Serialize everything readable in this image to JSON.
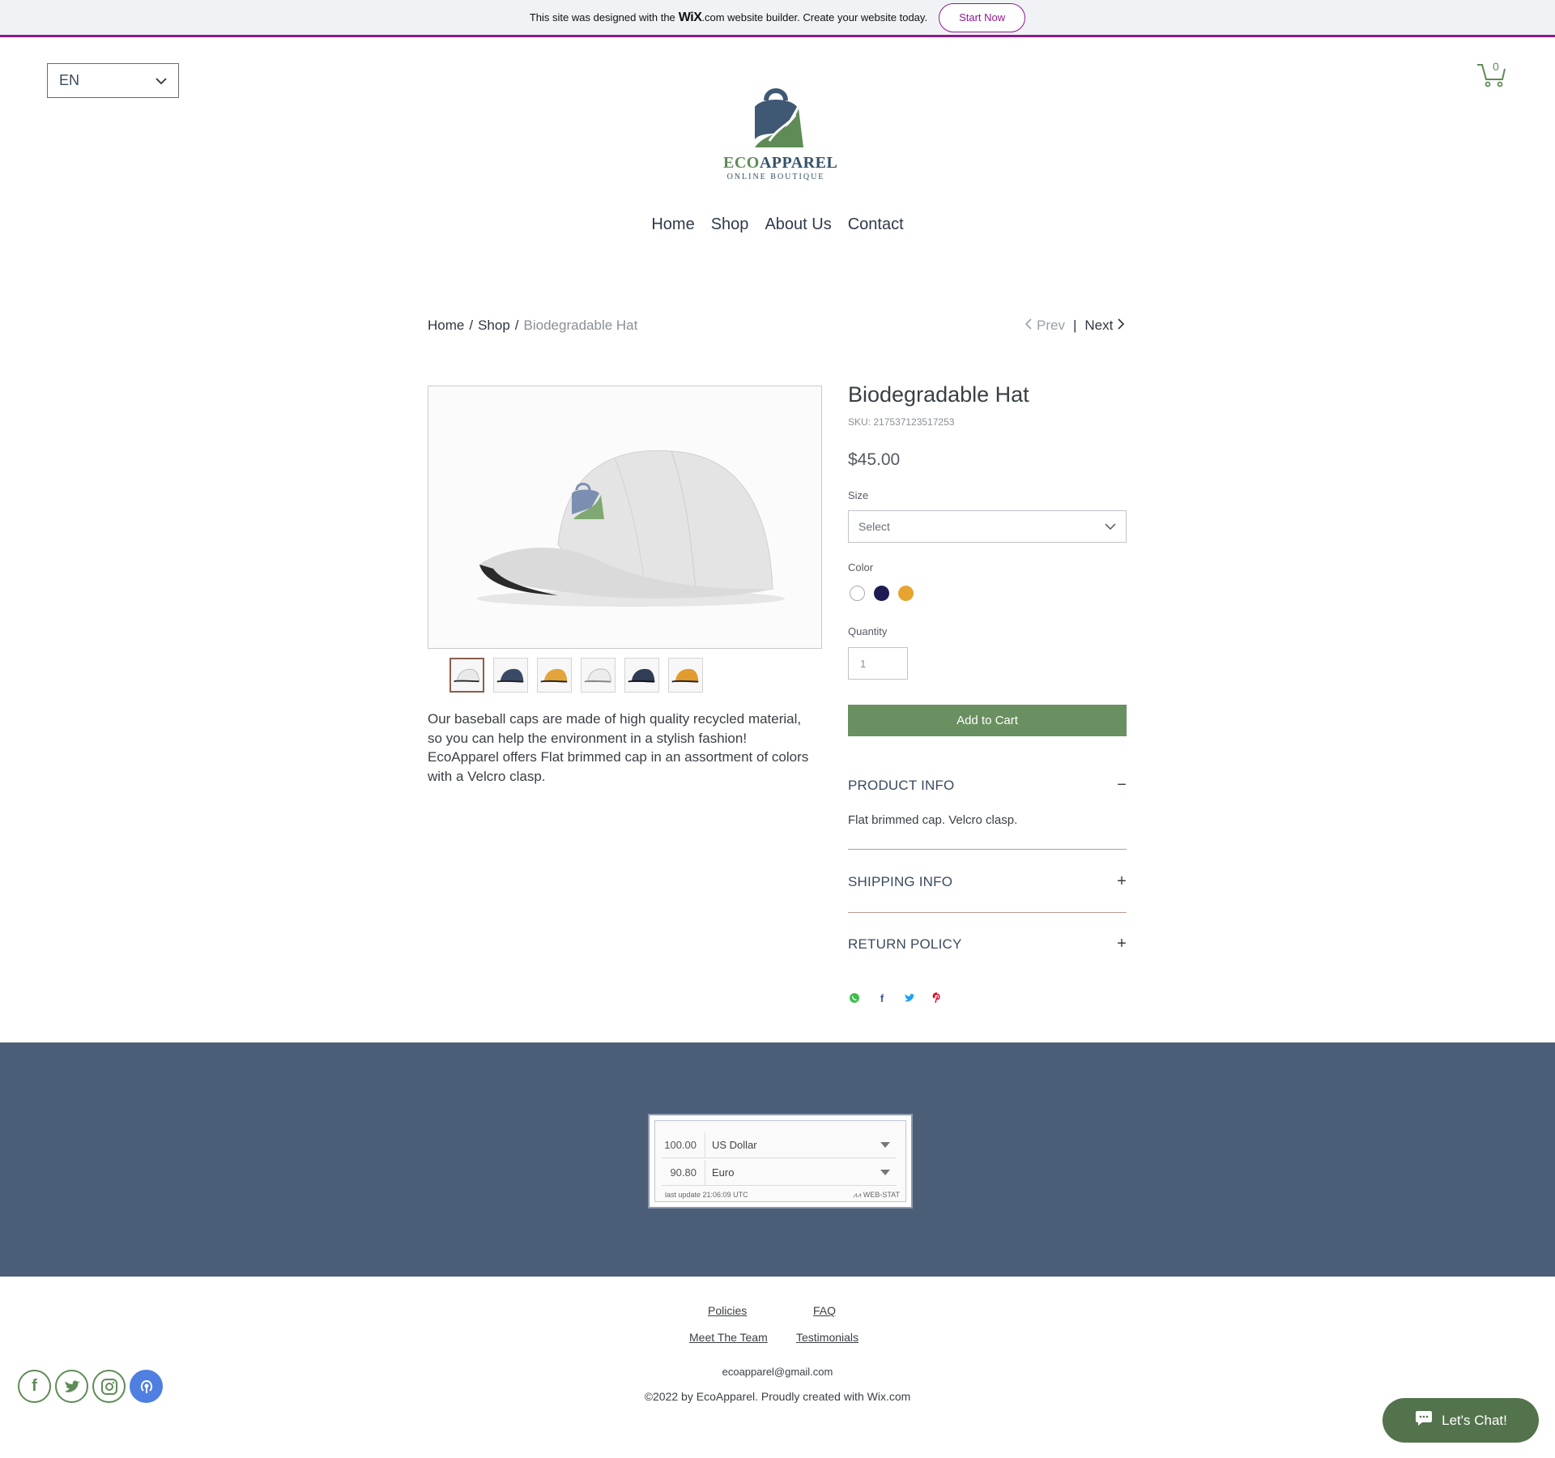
{
  "banner": {
    "text_before": "This site was designed with the",
    "brand": "WiX",
    "text_after": ".com website builder. Create your website today.",
    "cta": "Start Now"
  },
  "language": {
    "selected": "EN"
  },
  "cart": {
    "count": "0"
  },
  "logo": {
    "brand_eco": "ECO",
    "brand_apparel": "APPAREL",
    "subtitle": "ONLINE BOUTIQUE"
  },
  "nav": {
    "items": [
      "Home",
      "Shop",
      "About Us",
      "Contact"
    ]
  },
  "breadcrumb": {
    "home": "Home",
    "shop": "Shop",
    "current": "Biodegradable Hat",
    "sep": "/"
  },
  "pager": {
    "prev": "Prev",
    "next": "Next"
  },
  "product": {
    "title": "Biodegradable Hat",
    "sku": "SKU: 217537123517253",
    "price": "$45.00",
    "size_label": "Size",
    "size_value": "Select",
    "color_label": "Color",
    "colors": [
      "#ffffff",
      "#1e1b55",
      "#e8a330"
    ],
    "quantity_label": "Quantity",
    "quantity_value": "1",
    "add_to_cart": "Add to Cart",
    "description": "Our baseball caps are made of high quality recycled material, so you can help the environment in a stylish fashion!  EcoApparel offers Flat brimmed cap in an assortment of colors with a Velcro clasp.",
    "thumb_colors": [
      "#e9e9e9",
      "#3a4a66",
      "#e3a43a",
      "#ececec",
      "#2f3d57",
      "#e39a2e"
    ]
  },
  "accordion": {
    "product_info": {
      "title": "PRODUCT INFO",
      "symbol": "−",
      "body": "Flat brimmed cap. Velcro clasp."
    },
    "shipping_info": {
      "title": "SHIPPING INFO",
      "symbol": "+"
    },
    "return_policy": {
      "title": "RETURN POLICY",
      "symbol": "+"
    }
  },
  "converter": {
    "row1": {
      "amount": "100.00",
      "currency": "US Dollar"
    },
    "row2": {
      "amount": "90.80",
      "currency": "Euro"
    },
    "updated": "last update 21:06:09 UTC",
    "credit": "WEB-STAT"
  },
  "footer": {
    "links": {
      "policies": "Policies",
      "faq": "FAQ",
      "team": "Meet The Team",
      "testimonials": "Testimonials"
    },
    "email": "ecoapparel@gmail.com",
    "copyright": "©2022 by EcoApparel. Proudly created with Wix.com"
  },
  "chat": {
    "label": "Let's Chat!"
  },
  "colors": {
    "accent_green": "#6a8f60",
    "footer_band": "#4b5e78",
    "wix_purple": "#8e1a8e"
  }
}
